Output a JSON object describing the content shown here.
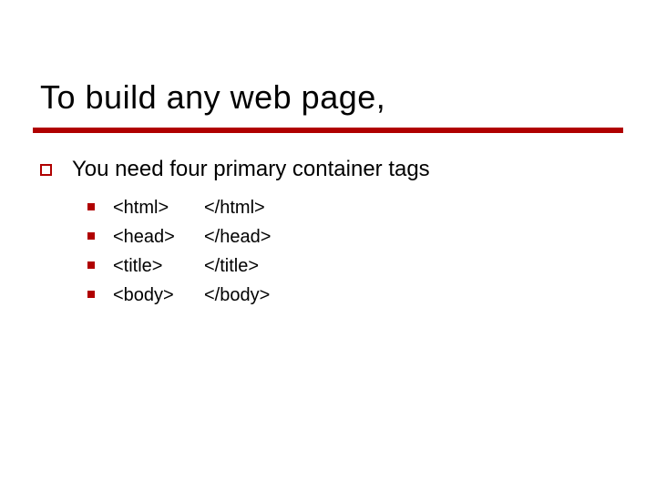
{
  "title": "To build any web page,",
  "lvl1_text": "You need four primary container tags",
  "items": [
    {
      "open": "<html>",
      "close": "</html>"
    },
    {
      "open": "<head>",
      "close": "</head>"
    },
    {
      "open": "<title>",
      "close": "</title>"
    },
    {
      "open": "<body>",
      "close": "</body>"
    }
  ]
}
